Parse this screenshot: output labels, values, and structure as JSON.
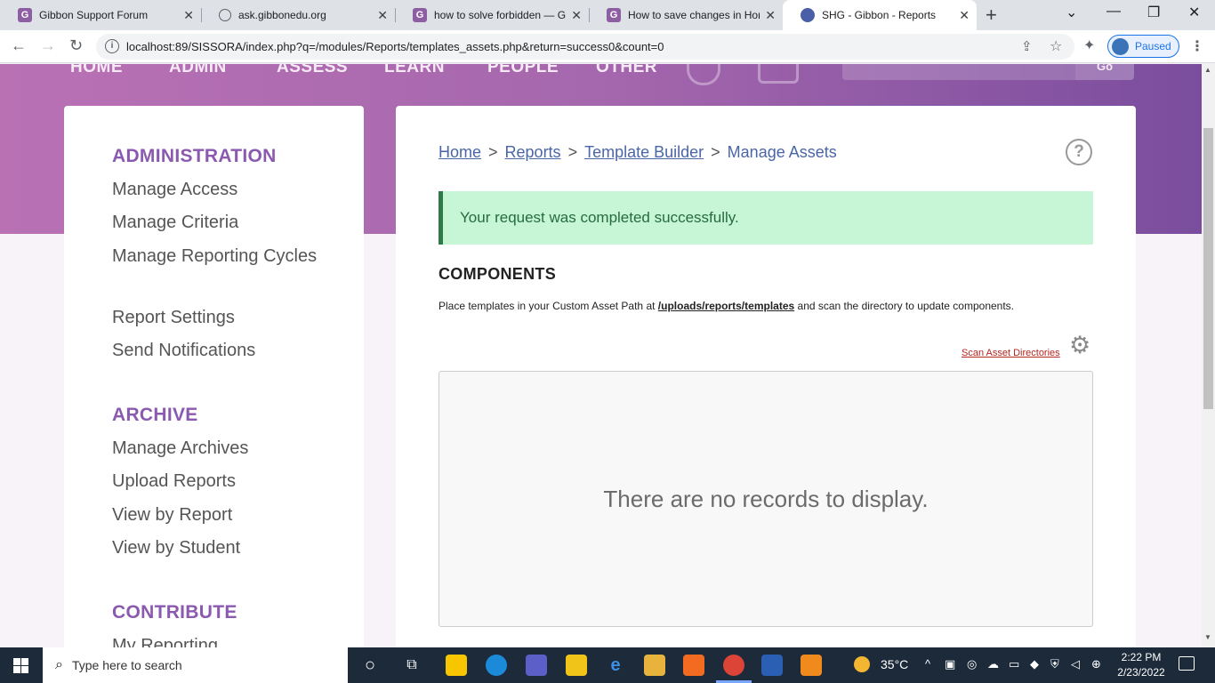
{
  "browser": {
    "tabs": [
      {
        "title": "Gibbon Support Forum",
        "icon": "gibbon-favicon-icon",
        "letter": "G"
      },
      {
        "title": "ask.gibbonedu.org",
        "icon": "globe-icon",
        "letter": ""
      },
      {
        "title": "how to solve forbidden — Gi",
        "icon": "gibbon-favicon-icon",
        "letter": "G"
      },
      {
        "title": "How to save changes in Hom",
        "icon": "gibbon-favicon-icon",
        "letter": "G"
      },
      {
        "title": "SHG - Gibbon - Reports",
        "icon": "shg-favicon-icon",
        "letter": ""
      }
    ],
    "active_tab": 4,
    "url": "localhost:89/SISSORA/index.php?q=/modules/Reports/templates_assets.php&return=success0&count=0",
    "profile_status": "Paused"
  },
  "topnav": {
    "items": [
      "HOME",
      "ADMIN",
      "ASSESS",
      "LEARN",
      "PEOPLE",
      "OTHER"
    ],
    "go_label": "Go"
  },
  "sidebar": {
    "sections": [
      {
        "heading": "ADMINISTRATION",
        "items": [
          "Manage Access",
          "Manage Criteria",
          "Manage Reporting Cycles",
          "Report Settings",
          "Send Notifications"
        ]
      },
      {
        "heading": "ARCHIVE",
        "items": [
          "Manage Archives",
          "Upload Reports",
          "View by Report",
          "View by Student"
        ]
      },
      {
        "heading": "CONTRIBUTE",
        "items": [
          "My Reporting"
        ]
      }
    ]
  },
  "main": {
    "breadcrumb": {
      "links": [
        "Home",
        "Reports",
        "Template Builder"
      ],
      "separator": ">",
      "current": "Manage Assets"
    },
    "help_icon": "?",
    "success_message": "Your request was completed successfully.",
    "section_title": "COMPONENTS",
    "description_before": "Place templates in your Custom Asset Path at",
    "description_path": "/uploads/reports/templates",
    "description_after": "and scan the directory to update components.",
    "scan_link": "Scan Asset Directories",
    "empty_message": "There are no records to display."
  },
  "taskbar": {
    "search_placeholder": "Type here to search",
    "weather": "35°C",
    "time": "2:22 PM",
    "date": "2/23/2022"
  },
  "colors": {
    "accent_purple": "#8b5ab0",
    "link_blue": "#4a66a6",
    "success_bg": "#c6f6d5",
    "danger_link": "#b3261e"
  }
}
